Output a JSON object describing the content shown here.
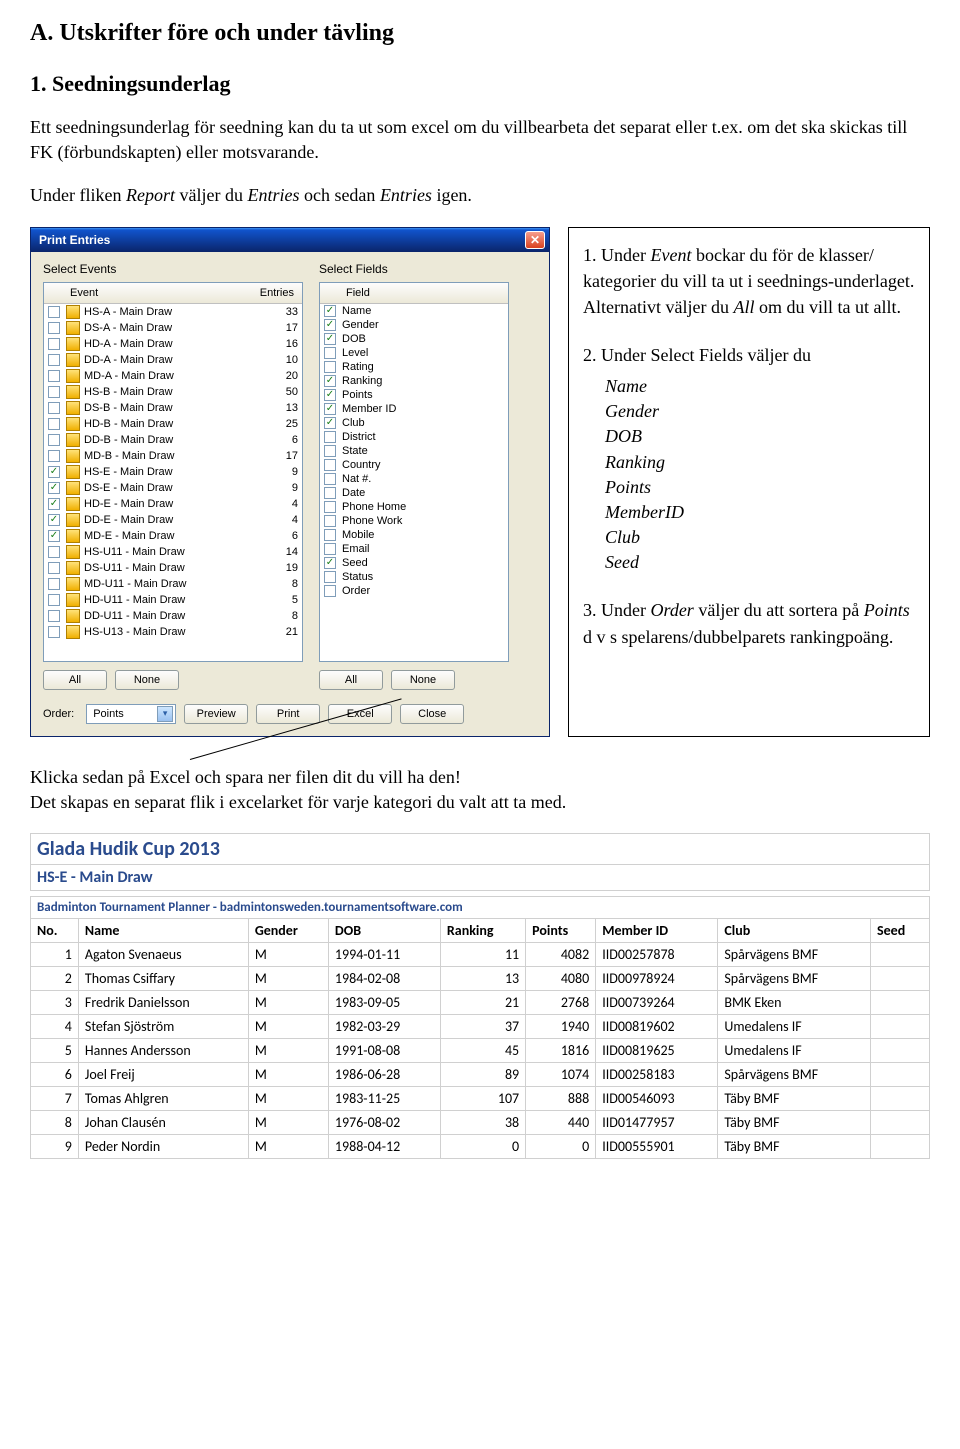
{
  "doc": {
    "heading_a": "A. Utskrifter före och under tävling",
    "heading_1": "1. Seedningsunderlag",
    "para1_pre": "Ett seedningsunderlag för seedning kan du ta ut som excel om du villbearbeta det separat eller t.ex. om det ska skickas till FK (förbundskapten) eller motsvarande.",
    "para2_a": "Under fliken ",
    "para2_report": "Report",
    "para2_b": " väljer du ",
    "para2_entries1": "Entries",
    "para2_c": " och sedan ",
    "para2_entries2": "Entries",
    "para2_d": " igen.",
    "klicka": "Klicka sedan på Excel och spara ner filen dit du vill ha den!",
    "skapas": "Det skapas en separat flik i excelarket för varje kategori du valt att ta med."
  },
  "dialog": {
    "title": "Print Entries",
    "sel_events": "Select Events",
    "sel_fields": "Select Fields",
    "hdr_event": "Event",
    "hdr_entries": "Entries",
    "hdr_field": "Field",
    "btn_all": "All",
    "btn_none": "None",
    "btn_preview": "Preview",
    "btn_print": "Print",
    "btn_excel": "Excel",
    "btn_close": "Close",
    "order_label": "Order:",
    "order_value": "Points",
    "events": [
      {
        "chk": false,
        "name": "HS-A - Main Draw",
        "entries": 33
      },
      {
        "chk": false,
        "name": "DS-A - Main Draw",
        "entries": 17
      },
      {
        "chk": false,
        "name": "HD-A - Main Draw",
        "entries": 16
      },
      {
        "chk": false,
        "name": "DD-A - Main Draw",
        "entries": 10
      },
      {
        "chk": false,
        "name": "MD-A - Main Draw",
        "entries": 20
      },
      {
        "chk": false,
        "name": "HS-B - Main Draw",
        "entries": 50
      },
      {
        "chk": false,
        "name": "DS-B - Main Draw",
        "entries": 13
      },
      {
        "chk": false,
        "name": "HD-B - Main Draw",
        "entries": 25
      },
      {
        "chk": false,
        "name": "DD-B - Main Draw",
        "entries": 6
      },
      {
        "chk": false,
        "name": "MD-B - Main Draw",
        "entries": 17
      },
      {
        "chk": true,
        "name": "HS-E - Main Draw",
        "entries": 9
      },
      {
        "chk": true,
        "name": "DS-E - Main Draw",
        "entries": 9
      },
      {
        "chk": true,
        "name": "HD-E - Main Draw",
        "entries": 4
      },
      {
        "chk": true,
        "name": "DD-E - Main Draw",
        "entries": 4
      },
      {
        "chk": true,
        "name": "MD-E - Main Draw",
        "entries": 6
      },
      {
        "chk": false,
        "name": "HS-U11 - Main Draw",
        "entries": 14
      },
      {
        "chk": false,
        "name": "DS-U11 - Main Draw",
        "entries": 19
      },
      {
        "chk": false,
        "name": "MD-U11 - Main Draw",
        "entries": 8
      },
      {
        "chk": false,
        "name": "HD-U11 - Main Draw",
        "entries": 5
      },
      {
        "chk": false,
        "name": "DD-U11 - Main Draw",
        "entries": 8
      },
      {
        "chk": false,
        "name": "HS-U13 - Main Draw",
        "entries": 21
      }
    ],
    "fields": [
      {
        "chk": true,
        "name": "Name"
      },
      {
        "chk": true,
        "name": "Gender"
      },
      {
        "chk": true,
        "name": "DOB"
      },
      {
        "chk": false,
        "name": "Level"
      },
      {
        "chk": false,
        "name": "Rating"
      },
      {
        "chk": true,
        "name": "Ranking"
      },
      {
        "chk": true,
        "name": "Points"
      },
      {
        "chk": true,
        "name": "Member ID"
      },
      {
        "chk": true,
        "name": "Club"
      },
      {
        "chk": false,
        "name": "District"
      },
      {
        "chk": false,
        "name": "State"
      },
      {
        "chk": false,
        "name": "Country"
      },
      {
        "chk": false,
        "name": "Nat #."
      },
      {
        "chk": false,
        "name": "Date"
      },
      {
        "chk": false,
        "name": "Phone Home"
      },
      {
        "chk": false,
        "name": "Phone Work"
      },
      {
        "chk": false,
        "name": "Mobile"
      },
      {
        "chk": false,
        "name": "Email"
      },
      {
        "chk": true,
        "name": "Seed"
      },
      {
        "chk": false,
        "name": "Status"
      },
      {
        "chk": false,
        "name": "Order"
      }
    ]
  },
  "instr": {
    "i1_a": "1. Under ",
    "i1_event": "Event",
    "i1_b": " bockar du för de klasser/ kategorier du vill ta ut i seednings-underlaget. Alternativt väljer du ",
    "i1_all": "All",
    "i1_c": " om du vill ta ut allt.",
    "i2": "2. Under Select Fields väljer du",
    "i2_fields": [
      "Name",
      "Gender",
      "DOB",
      "Ranking",
      "Points",
      "MemberID",
      "Club",
      "Seed"
    ],
    "i3_a": "3. Under ",
    "i3_order": "Order",
    "i3_b": " väljer du att sortera på ",
    "i3_points": "Points",
    "i3_c": " d v s spelarens/dubbelparets rankingpoäng."
  },
  "excel": {
    "title": "Glada Hudik Cup 2013",
    "subtitle": "HS-E - Main Draw",
    "credit": "Badminton Tournament Planner - badmintonsweden.tournamentsoftware.com",
    "headers": [
      "No.",
      "Name",
      "Gender",
      "DOB",
      "Ranking",
      "Points",
      "Member ID",
      "Club",
      "Seed"
    ],
    "rows": [
      {
        "no": 1,
        "name": "Agaton Svenaeus",
        "gender": "M",
        "dob": "1994-01-11",
        "ranking": 11,
        "points": 4082,
        "mid": "IID00257878",
        "club": "Spårvägens BMF",
        "seed": ""
      },
      {
        "no": 2,
        "name": "Thomas Csiffary",
        "gender": "M",
        "dob": "1984-02-08",
        "ranking": 13,
        "points": 4080,
        "mid": "IID00978924",
        "club": "Spårvägens BMF",
        "seed": ""
      },
      {
        "no": 3,
        "name": "Fredrik Danielsson",
        "gender": "M",
        "dob": "1983-09-05",
        "ranking": 21,
        "points": 2768,
        "mid": "IID00739264",
        "club": "BMK Eken",
        "seed": ""
      },
      {
        "no": 4,
        "name": "Stefan Sjöström",
        "gender": "M",
        "dob": "1982-03-29",
        "ranking": 37,
        "points": 1940,
        "mid": "IID00819602",
        "club": "Umedalens IF",
        "seed": ""
      },
      {
        "no": 5,
        "name": "Hannes Andersson",
        "gender": "M",
        "dob": "1991-08-08",
        "ranking": 45,
        "points": 1816,
        "mid": "IID00819625",
        "club": "Umedalens IF",
        "seed": ""
      },
      {
        "no": 6,
        "name": "Joel Freij",
        "gender": "M",
        "dob": "1986-06-28",
        "ranking": 89,
        "points": 1074,
        "mid": "IID00258183",
        "club": "Spårvägens BMF",
        "seed": ""
      },
      {
        "no": 7,
        "name": "Tomas Ahlgren",
        "gender": "M",
        "dob": "1983-11-25",
        "ranking": 107,
        "points": 888,
        "mid": "IID00546093",
        "club": "Täby BMF",
        "seed": ""
      },
      {
        "no": 8,
        "name": "Johan Clausén",
        "gender": "M",
        "dob": "1976-08-02",
        "ranking": 38,
        "points": 440,
        "mid": "IID01477957",
        "club": "Täby BMF",
        "seed": ""
      },
      {
        "no": 9,
        "name": "Peder Nordin",
        "gender": "M",
        "dob": "1988-04-12",
        "ranking": 0,
        "points": 0,
        "mid": "IID00555901",
        "club": "Täby BMF",
        "seed": ""
      }
    ]
  }
}
